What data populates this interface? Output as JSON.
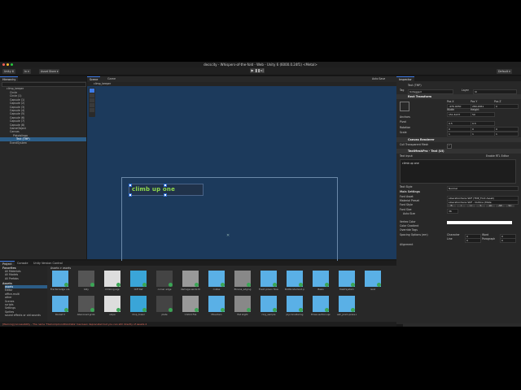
{
  "window": {
    "title": "decscity - Whispers-of-the-fold - Web - Unity 6 (6000.0.24f1) <Metal>"
  },
  "toolbar": {
    "account": "Unity 6",
    "cloud": "In ▾",
    "assetstore": "Asset Store ▾",
    "layout": "Default ▾"
  },
  "hierarchy": {
    "tab": "Hierarchy",
    "scene": "climp_keeper",
    "items": [
      "Circle",
      "Circle (1)",
      "Capsule (1)",
      "Capsule (2)",
      "Capsule (3)",
      "Capsule (4)",
      "Capsule (5)",
      "Capsule (6)",
      "Capsule (7)",
      "Capsule (8)",
      "GameObject",
      "Canvas",
      "Pistolslingo",
      "Text (TMP)",
      "EventSystem"
    ],
    "selected_index": 13
  },
  "scene": {
    "tabs": [
      "Scene",
      "Game"
    ],
    "breadcrumb": "climp_keeper",
    "tmp_text": "climb up one",
    "autosave": "Auto Save"
  },
  "inspector": {
    "tab": "Inspector",
    "object_name": "Text (TMP)",
    "tag_label": "Tag",
    "tag_value": "Untagged",
    "layer_label": "Layer",
    "layer_value": "UI",
    "rect_transform": "Rect Transform",
    "center": "center",
    "pos_labels": [
      "Pos X",
      "Pos Y",
      "Pos Z"
    ],
    "pos_values": [
      "-476.0450",
      "280.4651",
      "0"
    ],
    "size_labels": [
      "Width",
      "Height"
    ],
    "size_values": [
      "151.6137",
      "50"
    ],
    "anchors": "Anchors",
    "pivot_label": "Pivot",
    "pivot_x": "0.5",
    "pivot_y": "0.5",
    "rotation_label": "Rotation",
    "rotation": [
      "0",
      "0",
      "0"
    ],
    "scale_label": "Scale",
    "scale": [
      "1",
      "1",
      "1"
    ],
    "canvas_renderer": "Canvas Renderer",
    "cull": "Cull Transparent Mesh",
    "tmp_section": "TextMeshPro - Text (UI)",
    "text_input": "Text Input",
    "enable_rtl": "Enable RTL Editor",
    "text_value": "climb up one",
    "text_style_label": "Text Style",
    "text_style": "Normal",
    "main_settings": "Main Settings",
    "font_asset_label": "Font Asset",
    "font_asset": "LiberationSans SDF (TMP_Font Asset)",
    "material_label": "Material Preset",
    "material": "LiberationSans SDF - Outline (Mate",
    "font_style_label": "Font Style",
    "font_styles": [
      "B",
      "I",
      "U",
      "S",
      "ab",
      "AB",
      "SC"
    ],
    "font_size_label": "Font Size",
    "font_size": "36",
    "auto_size": "Auto Size",
    "vertex_color": "Vertex Color",
    "color_gradient": "Color Gradient",
    "override_tags": "Override Tags",
    "spacing_label": "Spacing Options (em)",
    "spacing_cols": [
      "Character",
      "Word",
      "Line",
      "Paragraph"
    ],
    "spacing_vals": [
      "0",
      "0",
      "0",
      "0"
    ],
    "alignment": "Alignment"
  },
  "project": {
    "tabs": [
      "Project",
      "Console",
      "Unity Version Control"
    ],
    "favorites": "Favorites",
    "fav_items": [
      "All Materials",
      "All Models",
      "All Prefabs"
    ],
    "assets_root": "Assets",
    "folders": [
      "assets",
      "Editor",
      "office-multi",
      "other",
      "Scenes",
      "scripts",
      "Settings",
      "Sprites",
      "sound effects or old sounds"
    ],
    "breadcrumb": "Assets > assets",
    "row1": [
      "Fractal ledge unl.",
      "billy",
      "climbing.sign",
      "Cliff Ref",
      "corner edge",
      "damage.sends the.",
      "crates",
      "Ekrana_edging",
      "Fresh prison flower",
      "BioWonderland.pen.",
      "Basis",
      "DashSystem",
      "rend"
    ],
    "row2": [
      "Rocket V",
      "Abanoned.grizz.",
      "slope",
      "drop_tower",
      "plate",
      "Unfold File",
      "Mountain",
      "flat slight",
      "ring_sample",
      "ply.considering",
      "three.section.sproc",
      "ash_pram.press.sp"
    ]
  },
  "status": {
    "message": "[Warning] Accessibility - The name 'TileCompConditionData' has been deprecated but you can still directly of assets 4"
  },
  "colors": {
    "accent": "#3d7ae6",
    "tmp_text": "#8fd94c",
    "scene_bg": "#1c3a5c"
  }
}
